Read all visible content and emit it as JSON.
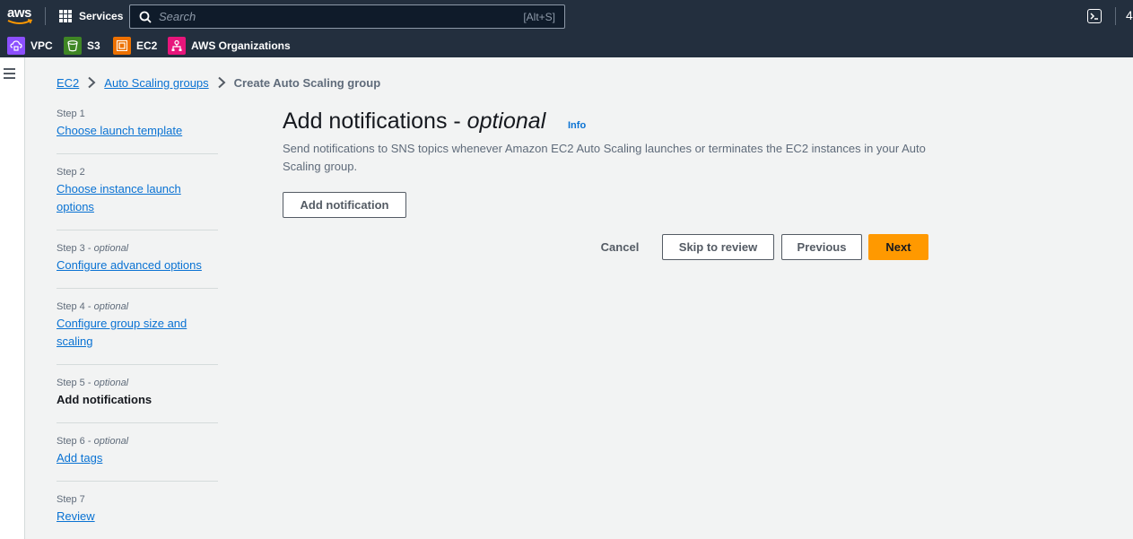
{
  "topnav": {
    "logo_text": "aws",
    "services_label": "Services",
    "search_placeholder": "Search",
    "search_shortcut": "[Alt+S]",
    "right_clip": "4"
  },
  "favorites": [
    {
      "label": "VPC",
      "icon": "vpc-icon",
      "color": "#8c4fff"
    },
    {
      "label": "S3",
      "icon": "s3-icon",
      "color": "#3f8624"
    },
    {
      "label": "EC2",
      "icon": "ec2-icon",
      "color": "#ed7100"
    },
    {
      "label": "AWS Organizations",
      "icon": "organizations-icon",
      "color": "#e7157b"
    }
  ],
  "breadcrumb": {
    "items": [
      "EC2",
      "Auto Scaling groups"
    ],
    "current": "Create Auto Scaling group"
  },
  "steps": [
    {
      "num": "Step 1",
      "optional": "",
      "label": "Choose launch template",
      "active": false
    },
    {
      "num": "Step 2",
      "optional": "",
      "label": "Choose instance launch options",
      "active": false
    },
    {
      "num": "Step 3",
      "optional": "optional",
      "label": "Configure advanced options",
      "active": false
    },
    {
      "num": "Step 4",
      "optional": "optional",
      "label": "Configure group size and scaling",
      "active": false
    },
    {
      "num": "Step 5",
      "optional": "optional",
      "label": "Add notifications",
      "active": true
    },
    {
      "num": "Step 6",
      "optional": "optional",
      "label": "Add tags",
      "active": false
    },
    {
      "num": "Step 7",
      "optional": "",
      "label": "Review",
      "active": false
    }
  ],
  "main": {
    "title": "Add notifications - ",
    "title_optional": "optional",
    "info": "Info",
    "description": "Send notifications to SNS topics whenever Amazon EC2 Auto Scaling launches or terminates the EC2 instances in your Auto Scaling group.",
    "add_notification": "Add notification",
    "cancel": "Cancel",
    "skip_to_review": "Skip to review",
    "previous": "Previous",
    "next": "Next"
  },
  "colors": {
    "nav_bg": "#232f3e",
    "link": "#0972d3",
    "primary": "#ff9900"
  }
}
